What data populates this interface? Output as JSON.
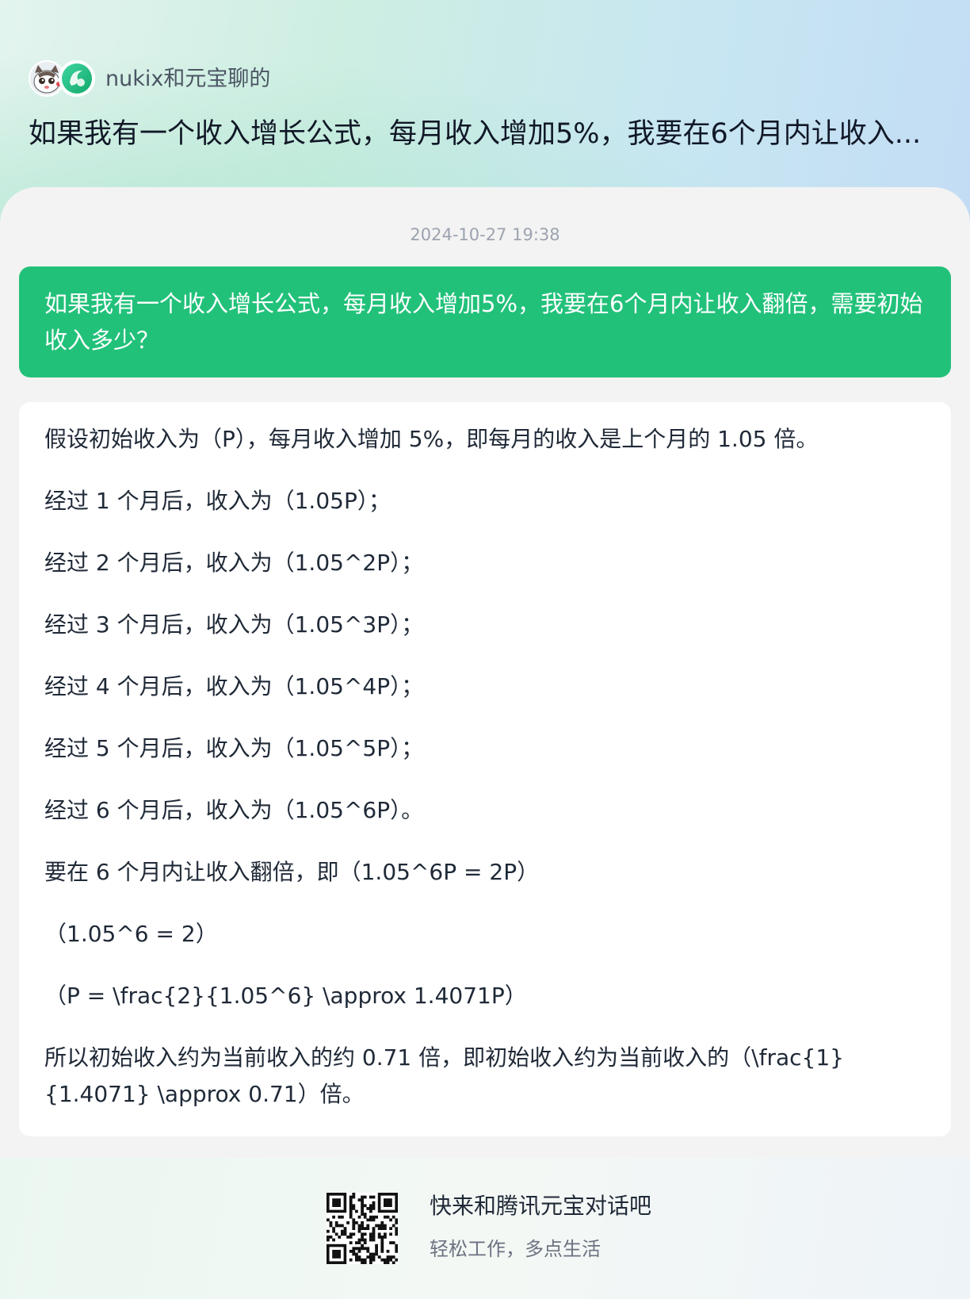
{
  "header": {
    "share_user_label": "nukix和元宝聊的",
    "conversation_title": "如果我有一个收入增长公式，每月收入增加5%，我要在6个月内让收入..."
  },
  "chat": {
    "timestamp": "2024-10-27 19:38",
    "user_message": "如果我有一个收入增长公式，每月收入增加5%，我要在6个月内让收入翻倍，需要初始收入多少？",
    "assistant_paragraphs": [
      "假设初始收入为（P），每月收入增加 5%，即每月的收入是上个月的 1.05 倍。",
      "经过 1 个月后，收入为（1.05P）；",
      "经过 2 个月后，收入为（1.05^2P）；",
      "经过 3 个月后，收入为（1.05^3P）；",
      "经过 4 个月后，收入为（1.05^4P）；",
      "经过 5 个月后，收入为（1.05^5P）；",
      "经过 6 个月后，收入为（1.05^6P）。",
      "要在 6 个月内让收入翻倍，即（1.05^6P = 2P）",
      "（1.05^6 = 2）",
      "（P = \\frac{2}{1.05^6} \\approx 1.4071P）",
      "所以初始收入约为当前收入的约 0.71 倍，即初始收入约为当前收入的（\\frac{1}{1.4071} \\approx 0.71）倍。"
    ]
  },
  "footer": {
    "cta_title": "快来和腾讯元宝对话吧",
    "cta_subtitle": "轻松工作，多点生活"
  },
  "icons": {
    "user_avatar": "cartoon-cat-avatar-icon",
    "bot_avatar": "yuanbao-logo-icon",
    "qr": "qr-code-icon"
  },
  "colors": {
    "accent_green": "#22c17a",
    "card_background": "#f3f3f3"
  }
}
